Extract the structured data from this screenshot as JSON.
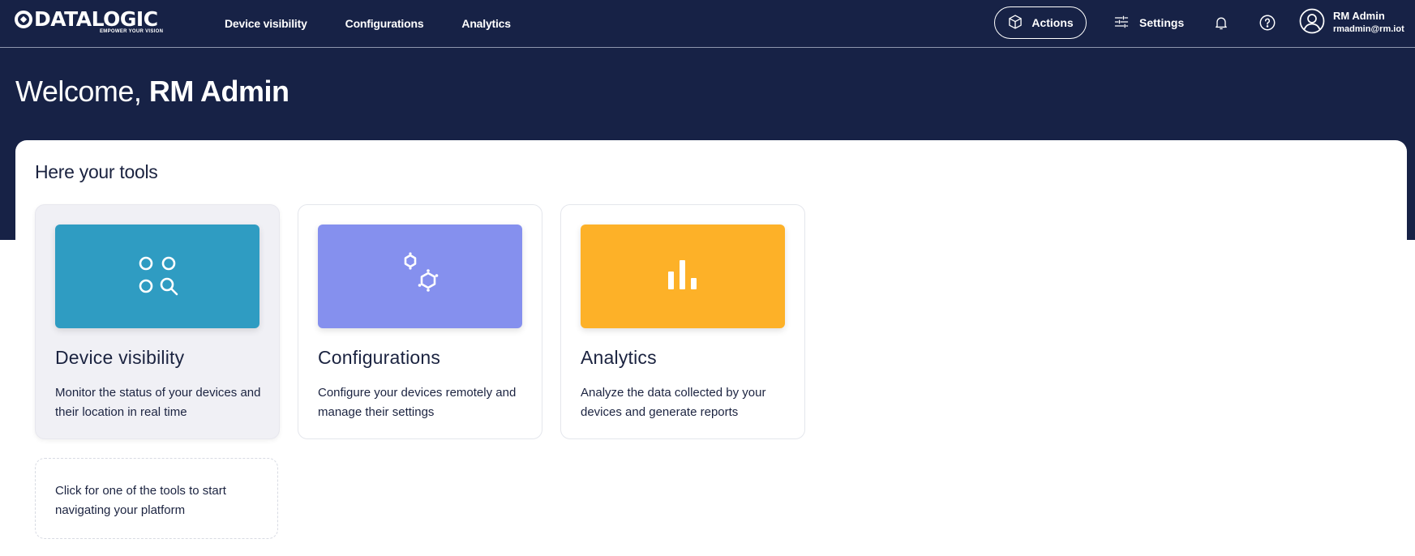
{
  "brand": {
    "name": "DATALOGIC",
    "tagline": "EMPOWER YOUR VISION"
  },
  "nav": {
    "items": [
      {
        "label": "Device visibility"
      },
      {
        "label": "Configurations"
      },
      {
        "label": "Analytics"
      }
    ]
  },
  "header": {
    "actions_label": "Actions",
    "settings_label": "Settings",
    "icons": [
      "cube-icon",
      "sliders-icon",
      "bell-icon",
      "help-icon",
      "user-icon"
    ]
  },
  "user": {
    "name": "RM Admin",
    "email": "rmadmin@rm.iot"
  },
  "welcome": {
    "prefix": "Welcome,",
    "name": "RM Admin"
  },
  "tools": {
    "title": "Here your tools",
    "cards": [
      {
        "title": "Device visibility",
        "description": "Monitor the status of your devices and their location in real time",
        "color": "#2f9cc2",
        "icon": "device-search-icon"
      },
      {
        "title": "Configurations",
        "description": "Configure your devices remotely and manage their settings",
        "color": "#8590ee",
        "icon": "cogs-icon"
      },
      {
        "title": "Analytics",
        "description": "Analyze the data collected by your devices and generate reports",
        "color": "#fdb128",
        "icon": "bar-chart-icon"
      }
    ],
    "hint": "Click for one of the tools to start navigating your platform"
  },
  "colors": {
    "header_bg": "#172246",
    "text_dark": "#1b2340"
  }
}
